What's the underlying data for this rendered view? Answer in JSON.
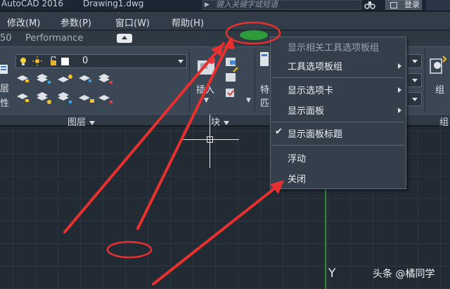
{
  "titlebar": {
    "app": "AutoCAD 2016",
    "document": "Drawing1.dwg",
    "search_placeholder": "键入关键字或短语",
    "login": "登录"
  },
  "menubar": {
    "items": [
      "修改(M)",
      "参数(P)",
      "窗口(W)",
      "帮助(H)"
    ]
  },
  "tabs": {
    "items": [
      "50",
      "Performance"
    ]
  },
  "ribbon": {
    "layer_value": "0",
    "left_labels": [
      "层",
      "性"
    ],
    "insert_label": "插入",
    "panels": [
      "图层",
      "块",
      "组"
    ],
    "right_group_label": "组",
    "partial_labels": [
      "特",
      "匹"
    ]
  },
  "context_menu": {
    "items": [
      {
        "label": "显示相关工具选项板组",
        "disabled": true
      },
      {
        "label": "工具选项板组",
        "submenu": true
      },
      {
        "label": "显示选项卡",
        "submenu": true
      },
      {
        "label": "显示面板",
        "submenu": true
      },
      {
        "label": "显示面板标题",
        "checked": true
      },
      {
        "label": "浮动"
      },
      {
        "label": "关闭"
      }
    ]
  },
  "canvas": {
    "axis_label": "Y"
  },
  "watermark": "头条 @橘同学",
  "colors": {
    "annotation_red": "#e8302e",
    "highlight_green": "#2e9a3a",
    "axis_green": "#2f8a3a"
  }
}
